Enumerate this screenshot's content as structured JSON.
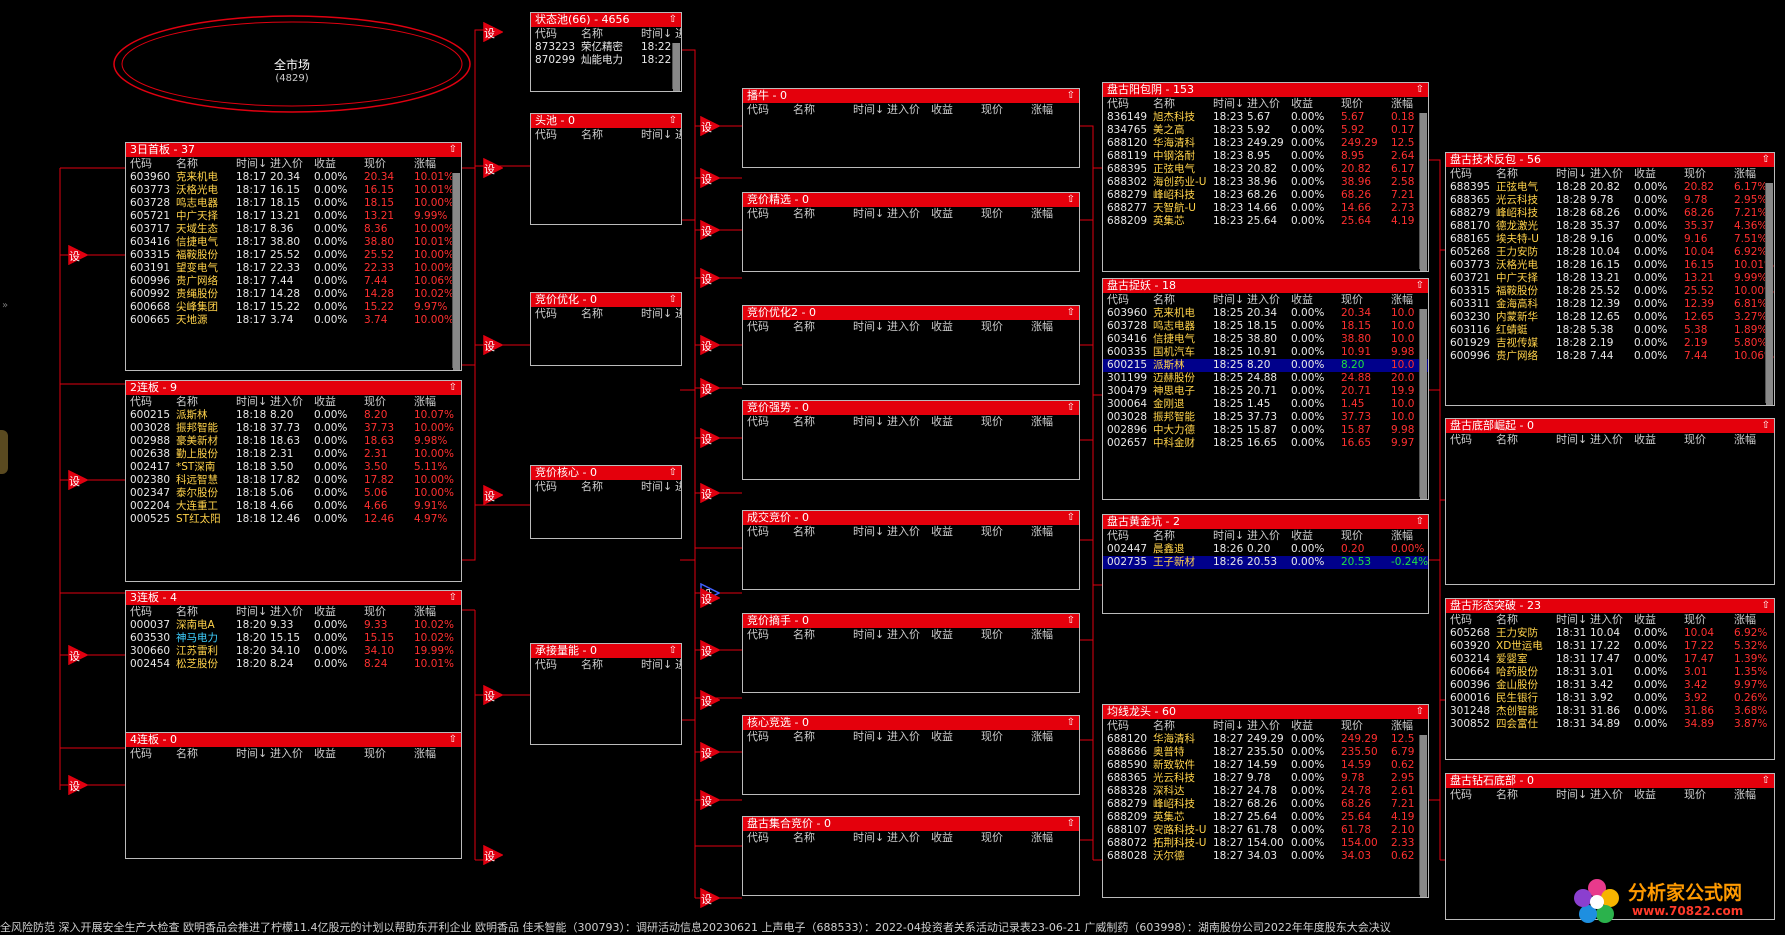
{
  "market": {
    "title": "全市场",
    "count": "(4829)"
  },
  "logo": {
    "line1": "分析家公式网",
    "line2": "www.70822.com"
  },
  "set_label": "设",
  "side_arrow": "»",
  "ticker": "全风险防范 深入开展安全生产大检查    欧明香品会推进了柠檬11.4亿股元的计划以帮助东开利企业  欧明香品    佳禾智能（300793）：调研活动信息20230621    上声电子（688533）：2022-04投资者关系活动记录表23-06-21    广威制药（603998）：湖南股份公司2022年年度股东大会决议",
  "columns": [
    "代码",
    "名称",
    "时间↓",
    "进入价",
    "收益",
    "现价",
    "涨幅"
  ],
  "short_columns": [
    "代码",
    "名称",
    "时间↓",
    "进"
  ],
  "up_icon": "⇧",
  "left_panels": [
    {
      "title": "3日首板 - 37",
      "rows": [
        [
          "603960",
          "克来机电",
          "18:17",
          "20.34",
          "0.00%",
          "20.34",
          "10.01%"
        ],
        [
          "603773",
          "沃格光电",
          "18:17",
          "16.15",
          "0.00%",
          "16.15",
          "10.01%"
        ],
        [
          "603728",
          "鸣志电器",
          "18:17",
          "18.15",
          "0.00%",
          "18.15",
          "10.00%"
        ],
        [
          "605721",
          "中广天择",
          "18:17",
          "13.21",
          "0.00%",
          "13.21",
          "9.99%"
        ],
        [
          "603717",
          "天域生态",
          "18:17",
          "8.36",
          "0.00%",
          "8.36",
          "10.00%"
        ],
        [
          "603416",
          "信捷电气",
          "18:17",
          "38.80",
          "0.00%",
          "38.80",
          "10.01%"
        ],
        [
          "603315",
          "福鞍股份",
          "18:17",
          "25.52",
          "0.00%",
          "25.52",
          "10.00%"
        ],
        [
          "603191",
          "望变电气",
          "18:17",
          "22.33",
          "0.00%",
          "22.33",
          "10.00%"
        ],
        [
          "600996",
          "贵广网络",
          "18:17",
          "7.44",
          "0.00%",
          "7.44",
          "10.06%"
        ],
        [
          "600992",
          "贵绳股份",
          "18:17",
          "14.28",
          "0.00%",
          "14.28",
          "10.02%"
        ],
        [
          "600668",
          "尖峰集团",
          "18:17",
          "15.22",
          "0.00%",
          "15.22",
          "9.97%"
        ],
        [
          "600665",
          "天地源",
          "18:17",
          "3.74",
          "0.00%",
          "3.74",
          "10.00%"
        ]
      ]
    },
    {
      "title": "2连板 - 9",
      "rows": [
        [
          "600215",
          "派斯林",
          "18:18",
          "8.20",
          "0.00%",
          "8.20",
          "10.07%"
        ],
        [
          "003028",
          "振邦智能",
          "18:18",
          "37.73",
          "0.00%",
          "37.73",
          "10.00%"
        ],
        [
          "002988",
          "豪美新材",
          "18:18",
          "18.63",
          "0.00%",
          "18.63",
          "9.98%"
        ],
        [
          "002638",
          "勤上股份",
          "18:18",
          "2.31",
          "0.00%",
          "2.31",
          "10.00%"
        ],
        [
          "002417",
          "*ST深南",
          "18:18",
          "3.50",
          "0.00%",
          "3.50",
          "5.11%"
        ],
        [
          "002380",
          "科远智慧",
          "18:18",
          "17.82",
          "0.00%",
          "17.82",
          "10.00%"
        ],
        [
          "002347",
          "泰尔股份",
          "18:18",
          "5.06",
          "0.00%",
          "5.06",
          "10.00%"
        ],
        [
          "002204",
          "大连重工",
          "18:18",
          "4.66",
          "0.00%",
          "4.66",
          "9.91%"
        ],
        [
          "000525",
          "ST红太阳",
          "18:18",
          "12.46",
          "0.00%",
          "12.46",
          "4.97%"
        ]
      ]
    },
    {
      "title": "3连板 - 4",
      "rows": [
        [
          "000037",
          "深南电A",
          "18:20",
          "9.33",
          "0.00%",
          "9.33",
          "10.02%"
        ],
        [
          "603530",
          "神马电力",
          "18:20",
          "15.15",
          "0.00%",
          "15.15",
          "10.02%"
        ],
        [
          "300660",
          "江苏雷利",
          "18:20",
          "34.10",
          "0.00%",
          "34.10",
          "19.99%"
        ],
        [
          "002454",
          "松芝股份",
          "18:20",
          "8.24",
          "0.00%",
          "8.24",
          "10.01%"
        ]
      ]
    },
    {
      "title": "4连板 - 0",
      "rows": []
    }
  ],
  "pool": {
    "title": "状态池(66) - 4656",
    "rows": [
      [
        "873223",
        "荣亿精密",
        "18:22"
      ],
      [
        "870299",
        "灿能电力",
        "18:22"
      ]
    ]
  },
  "mid_panels": [
    {
      "title": "头池 - 0"
    },
    {
      "title": "竞价优化 - 0"
    },
    {
      "title": "竞价核心 - 0"
    },
    {
      "title": "承接量能 - 0"
    }
  ],
  "right_mid_panels": [
    {
      "title": "播牛 - 0"
    },
    {
      "title": "竞价精选 - 0"
    },
    {
      "title": "竞价优化2 - 0"
    },
    {
      "title": "竞价强势 - 0"
    },
    {
      "title": "成交竞价 - 0"
    },
    {
      "title": "竞价摘手 - 0"
    },
    {
      "title": "核心竞选 - 0"
    },
    {
      "title": "盘古集合竞价 - 0"
    }
  ],
  "pangu_panels": [
    {
      "title": "盘古阳包阴 - 153",
      "rows": [
        [
          "836149",
          "旭杰科技",
          "18:23",
          "5.67",
          "0.00%",
          "5.67",
          "0.18"
        ],
        [
          "834765",
          "美之高",
          "18:23",
          "5.92",
          "0.00%",
          "5.92",
          "0.17"
        ],
        [
          "688120",
          "华海清科",
          "18:23",
          "249.29",
          "0.00%",
          "249.29",
          "12.5"
        ],
        [
          "688119",
          "中钢洛耐",
          "18:23",
          "8.95",
          "0.00%",
          "8.95",
          "2.64"
        ],
        [
          "688395",
          "正弦电气",
          "18:23",
          "20.82",
          "0.00%",
          "20.82",
          "6.17"
        ],
        [
          "688302",
          "海创药业-U",
          "18:23",
          "38.96",
          "0.00%",
          "38.96",
          "2.58"
        ],
        [
          "688279",
          "峰岹科技",
          "18:23",
          "68.26",
          "0.00%",
          "68.26",
          "7.21"
        ],
        [
          "688277",
          "天智航-U",
          "18:23",
          "14.66",
          "0.00%",
          "14.66",
          "2.73"
        ],
        [
          "688209",
          "英集芯",
          "18:23",
          "25.64",
          "0.00%",
          "25.64",
          "4.19"
        ]
      ]
    },
    {
      "title": "盘古捉妖 - 18",
      "sel": 4,
      "rows": [
        [
          "603960",
          "克来机电",
          "18:25",
          "20.34",
          "0.00%",
          "20.34",
          "10.0"
        ],
        [
          "603728",
          "鸣志电器",
          "18:25",
          "18.15",
          "0.00%",
          "18.15",
          "10.0"
        ],
        [
          "603416",
          "信捷电气",
          "18:25",
          "38.80",
          "0.00%",
          "38.80",
          "10.0"
        ],
        [
          "600335",
          "国机汽车",
          "18:25",
          "10.91",
          "0.00%",
          "10.91",
          "9.98"
        ],
        [
          "600215",
          "派斯林",
          "18:25",
          "8.20",
          "0.00%",
          "8.20",
          "10.0"
        ],
        [
          "301199",
          "迈赫股份",
          "18:25",
          "24.88",
          "0.00%",
          "24.88",
          "20.0"
        ],
        [
          "300479",
          "神思电子",
          "18:25",
          "20.71",
          "0.00%",
          "20.71",
          "19.9"
        ],
        [
          "300064",
          "金刚退",
          "18:25",
          "1.45",
          "0.00%",
          "1.45",
          "10.0"
        ],
        [
          "003028",
          "振邦智能",
          "18:25",
          "37.73",
          "0.00%",
          "37.73",
          "10.0"
        ],
        [
          "002896",
          "中大力德",
          "18:25",
          "15.87",
          "0.00%",
          "15.87",
          "9.98"
        ],
        [
          "002657",
          "中科金财",
          "18:25",
          "16.65",
          "0.00%",
          "16.65",
          "9.97"
        ]
      ]
    },
    {
      "title": "盘古黄金坑 - 2",
      "sel": 1,
      "rows": [
        [
          "002447",
          "晨鑫退",
          "18:26",
          "0.20",
          "0.00%",
          "0.20",
          "0.00%"
        ],
        [
          "002735",
          "王子新材",
          "18:26",
          "20.53",
          "0.00%",
          "20.53",
          "-0.24%"
        ]
      ]
    },
    {
      "title": "均线龙头 - 60",
      "rows": [
        [
          "688120",
          "华海清科",
          "18:27",
          "249.29",
          "0.00%",
          "249.29",
          "12.5"
        ],
        [
          "688686",
          "奥普特",
          "18:27",
          "235.50",
          "0.00%",
          "235.50",
          "6.79"
        ],
        [
          "688590",
          "新致软件",
          "18:27",
          "14.59",
          "0.00%",
          "14.59",
          "0.62"
        ],
        [
          "688365",
          "光云科技",
          "18:27",
          "9.78",
          "0.00%",
          "9.78",
          "2.95"
        ],
        [
          "688328",
          "深科达",
          "18:27",
          "24.78",
          "0.00%",
          "24.78",
          "2.61"
        ],
        [
          "688279",
          "峰岹科技",
          "18:27",
          "68.26",
          "0.00%",
          "68.26",
          "7.21"
        ],
        [
          "688209",
          "英集芯",
          "18:27",
          "25.64",
          "0.00%",
          "25.64",
          "4.19"
        ],
        [
          "688107",
          "安路科技-U",
          "18:27",
          "61.78",
          "0.00%",
          "61.78",
          "2.10"
        ],
        [
          "688072",
          "拓荆科技-U",
          "18:27",
          "154.00",
          "0.00%",
          "154.00",
          "2.33"
        ],
        [
          "688028",
          "沃尔德",
          "18:27",
          "34.03",
          "0.00%",
          "34.03",
          "0.62"
        ]
      ]
    }
  ],
  "far_panels": [
    {
      "title": "盘古技术反包 - 56",
      "rows": [
        [
          "688395",
          "正弦电气",
          "18:28",
          "20.82",
          "0.00%",
          "20.82",
          "6.17%"
        ],
        [
          "688365",
          "光云科技",
          "18:28",
          "9.78",
          "0.00%",
          "9.78",
          "2.95%"
        ],
        [
          "688279",
          "峰岹科技",
          "18:28",
          "68.26",
          "0.00%",
          "68.26",
          "7.21%"
        ],
        [
          "688170",
          "德龙激光",
          "18:28",
          "35.37",
          "0.00%",
          "35.37",
          "4.36%"
        ],
        [
          "688165",
          "埃夫特-U",
          "18:28",
          "9.16",
          "0.00%",
          "9.16",
          "7.51%"
        ],
        [
          "605268",
          "王力安防",
          "18:28",
          "10.04",
          "0.00%",
          "10.04",
          "6.92%"
        ],
        [
          "603773",
          "沃格光电",
          "18:28",
          "16.15",
          "0.00%",
          "16.15",
          "10.01%"
        ],
        [
          "603721",
          "中广天择",
          "18:28",
          "13.21",
          "0.00%",
          "13.21",
          "9.99%"
        ],
        [
          "603315",
          "福鞍股份",
          "18:28",
          "25.52",
          "0.00%",
          "25.52",
          "10.00%"
        ],
        [
          "603311",
          "金海高科",
          "18:28",
          "12.39",
          "0.00%",
          "12.39",
          "6.81%"
        ],
        [
          "603230",
          "内蒙新华",
          "18:28",
          "12.65",
          "0.00%",
          "12.65",
          "3.27%"
        ],
        [
          "603116",
          "红蜻蜓",
          "18:28",
          "5.38",
          "0.00%",
          "5.38",
          "1.89%"
        ],
        [
          "601929",
          "吉视传媒",
          "18:28",
          "2.19",
          "0.00%",
          "2.19",
          "5.80%"
        ],
        [
          "600996",
          "贵广网络",
          "18:28",
          "7.44",
          "0.00%",
          "7.44",
          "10.06%"
        ]
      ]
    },
    {
      "title": "盘古底部崛起 - 0",
      "rows": []
    },
    {
      "title": "盘古形态突破 - 23",
      "rows": [
        [
          "605268",
          "王力安防",
          "18:31",
          "10.04",
          "0.00%",
          "10.04",
          "6.92%"
        ],
        [
          "603920",
          "XD世运电",
          "18:31",
          "17.22",
          "0.00%",
          "17.22",
          "5.32%"
        ],
        [
          "603214",
          "爱婴室",
          "18:31",
          "17.47",
          "0.00%",
          "17.47",
          "1.39%"
        ],
        [
          "600664",
          "哈药股份",
          "18:31",
          "3.01",
          "0.00%",
          "3.01",
          "1.35%"
        ],
        [
          "600396",
          "金山股份",
          "18:31",
          "3.42",
          "0.00%",
          "3.42",
          "9.97%"
        ],
        [
          "600016",
          "民生银行",
          "18:31",
          "3.92",
          "0.00%",
          "3.92",
          "0.26%"
        ],
        [
          "301248",
          "杰创智能",
          "18:31",
          "31.86",
          "0.00%",
          "31.86",
          "3.68%"
        ],
        [
          "300852",
          "四会富仕",
          "18:31",
          "34.89",
          "0.00%",
          "34.89",
          "3.87%"
        ]
      ]
    },
    {
      "title": "盘古钻石底部 - 0",
      "rows": []
    }
  ]
}
